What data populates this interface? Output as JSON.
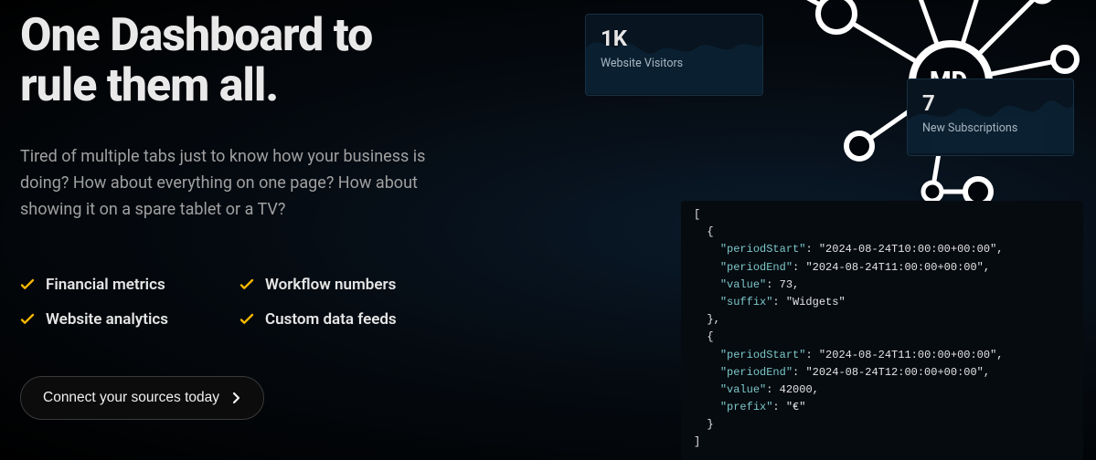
{
  "hero": {
    "title_line1": "One Dashboard to",
    "title_line2": "rule them all.",
    "description": "Tired of multiple tabs just to know how your business is doing? How about everything on one page? How about showing it on a spare tablet or a TV?"
  },
  "features": [
    "Financial metrics",
    "Workflow numbers",
    "Website analytics",
    "Custom data feeds"
  ],
  "cta": {
    "label": "Connect your sources today"
  },
  "cards": {
    "visitors": {
      "value": "1K",
      "label": "Website Visitors"
    },
    "subs": {
      "value": "7",
      "label": "New Subscriptions"
    }
  },
  "logo": {
    "text": "MD"
  },
  "code": {
    "lines": [
      {
        "t": "punc",
        "v": "["
      },
      {
        "t": "punc",
        "v": "  {"
      },
      {
        "t": "kv",
        "k": "periodStart",
        "v": "\"2024-08-24T10:00:00+00:00\"",
        "trail": ","
      },
      {
        "t": "kv",
        "k": "periodEnd",
        "v": "\"2024-08-24T11:00:00+00:00\"",
        "trail": ","
      },
      {
        "t": "kvnum",
        "k": "value",
        "v": "73",
        "trail": ","
      },
      {
        "t": "kv",
        "k": "suffix",
        "v": "\"Widgets\"",
        "trail": ""
      },
      {
        "t": "punc",
        "v": "  },"
      },
      {
        "t": "punc",
        "v": "  {"
      },
      {
        "t": "kv",
        "k": "periodStart",
        "v": "\"2024-08-24T11:00:00+00:00\"",
        "trail": ","
      },
      {
        "t": "kv",
        "k": "periodEnd",
        "v": "\"2024-08-24T12:00:00+00:00\"",
        "trail": ","
      },
      {
        "t": "kvnum",
        "k": "value",
        "v": "42000",
        "trail": ","
      },
      {
        "t": "kv",
        "k": "prefix",
        "v": "\"€\"",
        "trail": ""
      },
      {
        "t": "punc",
        "v": "  }"
      },
      {
        "t": "punc",
        "v": "]"
      }
    ]
  },
  "colors": {
    "accent": "#f5b700",
    "card_bg": "#08141f",
    "card_border": "#163044",
    "spark_fill": "#0e2a40"
  }
}
